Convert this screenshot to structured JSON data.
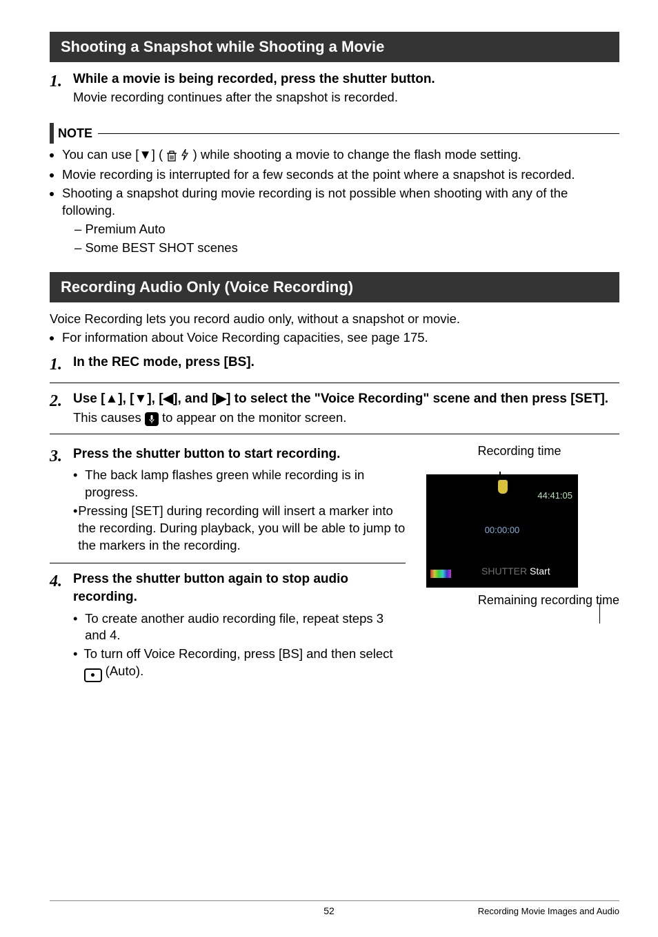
{
  "sections": {
    "snapshot": {
      "title": "Shooting a Snapshot while Shooting a Movie",
      "step1": {
        "title": "While a movie is being recorded, press the shutter button.",
        "text": "Movie recording continues after the snapshot is recorded."
      },
      "note_label": "NOTE",
      "bullets": {
        "b1a": "You can use [",
        "b1b": "] (",
        "b1c": ") while shooting a movie to change the flash mode setting.",
        "b2": "Movie recording is interrupted for a few seconds at the point where a snapshot is recorded.",
        "b3": "Shooting a snapshot during movie recording is not possible when shooting with any of the following.",
        "s1": "Premium Auto",
        "s2": "Some BEST SHOT scenes"
      }
    },
    "voice": {
      "title": "Recording Audio Only (Voice Recording)",
      "intro1": "Voice Recording lets you record audio only, without a snapshot or movie.",
      "intro2": "For information about Voice Recording capacities, see page 175.",
      "step1": "In the REC mode, press [BS].",
      "step2a": "Use [",
      "step2b": "], [",
      "step2c": "], [",
      "step2d": "], and [",
      "step2e": "] to select the \"Voice Recording\" scene and then press [SET].",
      "step2txt_a": "This causes ",
      "step2txt_b": " to appear on the monitor screen.",
      "step3": {
        "title": "Press the shutter button to start recording.",
        "b1": "The back lamp flashes green while recording is in progress.",
        "b2": "Pressing [SET] during recording will insert a marker into the recording. During playback, you will be able to jump to the markers in the recording."
      },
      "step4": {
        "title": "Press the shutter button again to stop audio recording.",
        "b1": "To create another audio recording file, repeat steps 3 and 4.",
        "b2a": "To turn off Voice Recording, press [BS] and then select ",
        "b2b": " (Auto)."
      },
      "screen": {
        "label_top": "Recording time",
        "remaining": "44:41:05",
        "elapsed": "00:00:00",
        "shutter_pre": "SHUTTER",
        "start": "Start",
        "label_bottom": "Remaining recording time"
      }
    }
  },
  "arrows": {
    "up": "▲",
    "down": "▼",
    "left": "◀",
    "right": "▶"
  },
  "footer": {
    "page": "52",
    "section": "Recording Movie Images and Audio"
  }
}
